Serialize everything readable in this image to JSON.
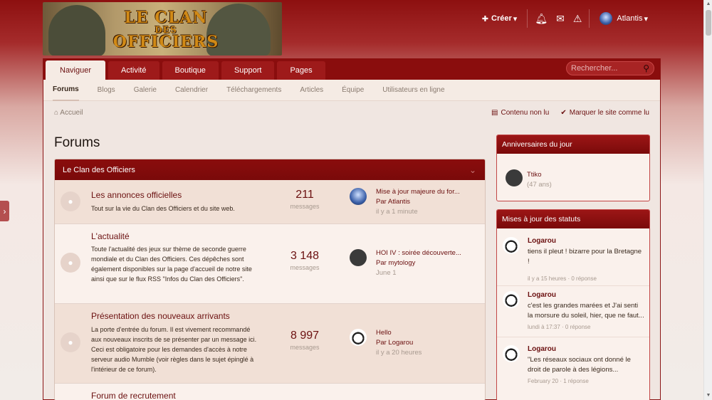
{
  "logo": {
    "line1": "LE CLAN",
    "line2": "DES",
    "line3": "OFFICIERS"
  },
  "user_nav": {
    "create_label": "Créer",
    "username": "Atlantis"
  },
  "nav": {
    "tabs": [
      "Naviguer",
      "Activité",
      "Boutique",
      "Support",
      "Pages"
    ],
    "search_placeholder": "Rechercher..."
  },
  "subnav": [
    "Forums",
    "Blogs",
    "Galerie",
    "Calendrier",
    "Téléchargements",
    "Articles",
    "Équipe",
    "Utilisateurs en ligne"
  ],
  "breadcrumb": {
    "home": "Accueil",
    "unread": "Contenu non lu",
    "mark_read": "Marquer le site comme lu"
  },
  "page_title": "Forums",
  "category": {
    "title": "Le Clan des Officiers"
  },
  "forums": [
    {
      "title": "Les annonces officielles",
      "desc": "Tout sur la vie du Clan des Officiers et du site web.",
      "count": "211",
      "count_label": "messages",
      "last_title": "Mise à jour majeure du for...",
      "last_by": "Par Atlantis",
      "last_time": "il y a 1 minute"
    },
    {
      "title": "L'actualité",
      "desc": "Toute l'actualité des jeux sur thème de seconde guerre mondiale et du Clan des Officiers. Ces dépêches sont également disponibles sur la page d'accueil de notre site ainsi que sur le flux RSS \"Infos du Clan des Officiers\".",
      "count": "3 148",
      "count_label": "messages",
      "last_title": "HOI IV : soirée découverte...",
      "last_by": "Par mytology",
      "last_time": "June 1"
    },
    {
      "title": "Présentation des nouveaux arrivants",
      "desc": "La porte d'entrée du forum. Il est vivement recommandé aux nouveaux inscrits de se présenter par un message ici. Ceci est obligatoire pour les demandes d'accès à notre serveur audio Mumble (voir règles dans le sujet épinglé à l'intérieur de ce forum).",
      "count": "8 997",
      "count_label": "messages",
      "last_title": "Hello",
      "last_by": "Par Logarou",
      "last_time": "il y a 20 heures"
    },
    {
      "title": "Forum de recrutement"
    }
  ],
  "sidebar": {
    "birthdays": {
      "title": "Anniversaires du jour",
      "name": "Ttiko",
      "age": "(47 ans)"
    },
    "statuses": {
      "title": "Mises à jour des statuts",
      "items": [
        {
          "name": "Logarou",
          "message": "tiens il pleut ! bizarre pour la Bretagne !",
          "meta": "il y a 15 heures · 0 réponse"
        },
        {
          "name": "Logarou",
          "message": "c'est les grandes marées et J'ai senti la morsure du soleil, hier, que ne faut...",
          "meta": "lundi à 17:37 · 0 réponse"
        },
        {
          "name": "Logarou",
          "message": "\"Les réseaux sociaux ont donné le droit de parole à des légions...",
          "meta": "February 20 · 1 réponse"
        }
      ]
    }
  }
}
